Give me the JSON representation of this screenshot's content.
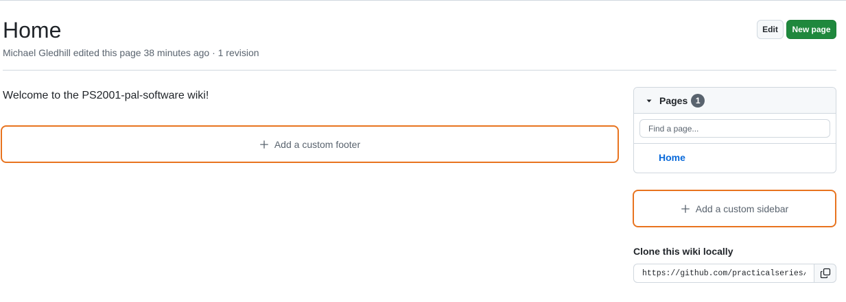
{
  "page": {
    "title": "Home",
    "meta": "Michael Gledhill edited this page 38 minutes ago · 1 revision"
  },
  "actions": {
    "edit_label": "Edit",
    "new_page_label": "New page"
  },
  "content": {
    "welcome": "Welcome to the PS2001-pal-software wiki!",
    "add_footer_label": "Add a custom footer"
  },
  "sidebar": {
    "pages_title": "Pages",
    "pages_count": "1",
    "search_placeholder": "Find a page...",
    "pages": [
      {
        "label": "Home"
      }
    ],
    "add_sidebar_label": "Add a custom sidebar"
  },
  "clone": {
    "heading": "Clone this wiki locally",
    "url": "https://github.com/practicalseries/P"
  },
  "colors": {
    "accent_outline": "#e8731e",
    "primary_button": "#1f883d",
    "link": "#0969da"
  },
  "icons": [
    "plus-icon",
    "caret-down-icon",
    "copy-icon"
  ]
}
